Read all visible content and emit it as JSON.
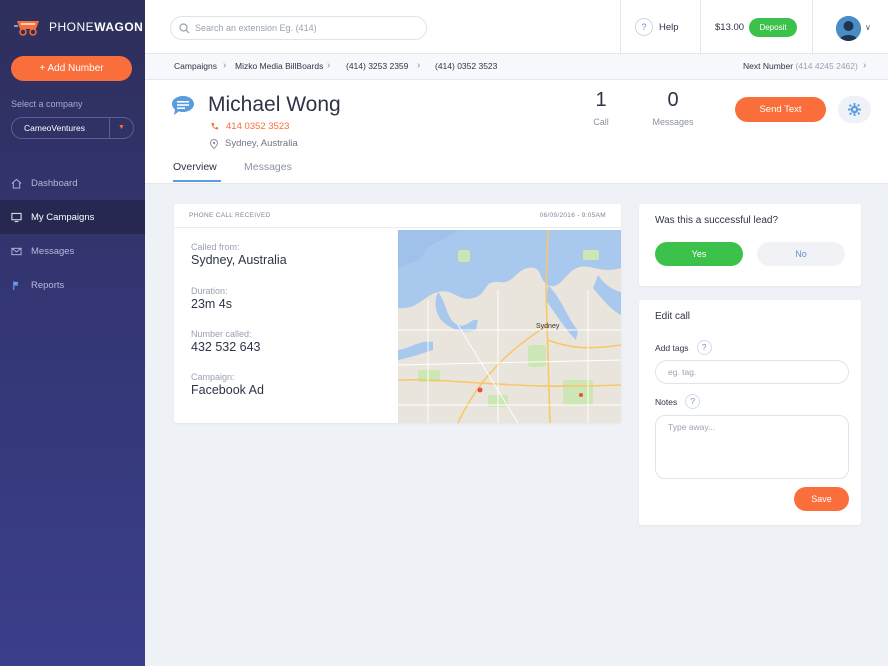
{
  "app": {
    "logo_text_light": "PHONE",
    "logo_text_bold": "WAGON"
  },
  "sidebar": {
    "add_number_label": "+ Add Number",
    "company_label": "Select a company",
    "company_value": "CameoVentures",
    "items": [
      {
        "label": "Dashboard",
        "icon": "home-icon"
      },
      {
        "label": "My Campaigns",
        "icon": "monitor-icon",
        "active": true
      },
      {
        "label": "Messages",
        "icon": "envelope-icon"
      },
      {
        "label": "Reports",
        "icon": "flag-icon"
      }
    ]
  },
  "topbar": {
    "search_placeholder": "Search an extension Eg. (414)",
    "help_label": "Help",
    "balance": "$13.00",
    "deposit_label": "Deposit"
  },
  "breadcrumb": {
    "items": [
      "Campaigns",
      "Mizko Media BillBoards",
      "(414) 3253 2359",
      "(414) 0352 3523"
    ],
    "next_label": "Next Number",
    "next_value": "(414 4245 2462)"
  },
  "contact": {
    "name": "Michael Wong",
    "phone": "414 0352 3523",
    "location": "Sydney, Australia",
    "calls_count": "1",
    "calls_label": "Call",
    "messages_count": "0",
    "messages_label": "Messages",
    "send_text_label": "Send Text"
  },
  "tabs": [
    {
      "label": "Overview",
      "active": true
    },
    {
      "label": "Messages",
      "active": false
    }
  ],
  "call": {
    "heading": "PHONE CALL RECEIVED",
    "timestamp": "06/09/2016 - 9:05AM",
    "fields": [
      {
        "label": "Called from:",
        "value": "Sydney, Australia"
      },
      {
        "label": "Duration:",
        "value": "23m 4s"
      },
      {
        "label": "Number called:",
        "value": "432 532 643"
      },
      {
        "label": "Campaign:",
        "value": "Facebook Ad"
      }
    ],
    "map_city_label": "Sydney"
  },
  "lead": {
    "question": "Was this a successful lead?",
    "yes_label": "Yes",
    "no_label": "No"
  },
  "edit_call": {
    "title": "Edit call",
    "tags_label": "Add tags",
    "tags_placeholder": "eg. tag.",
    "notes_label": "Notes",
    "notes_placeholder": "Type away...",
    "save_label": "Save"
  },
  "colors": {
    "accent": "#f96e3a",
    "success": "#3cc14b",
    "sidebar": "#2e2f5c",
    "link": "#5b9be0"
  }
}
